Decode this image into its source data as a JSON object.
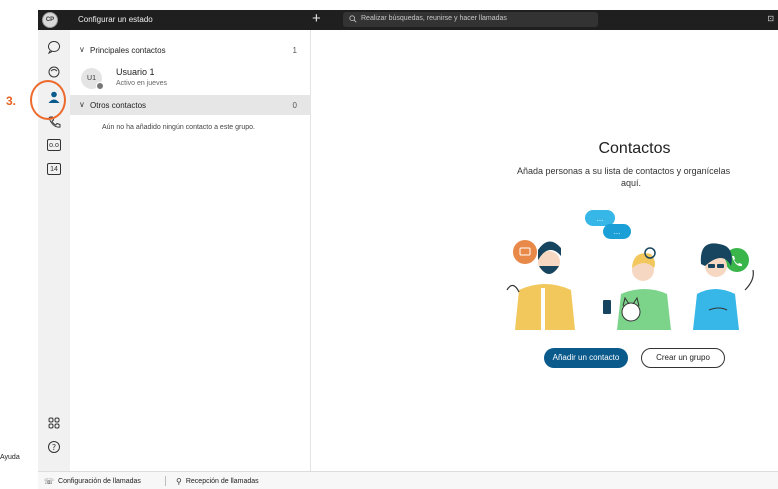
{
  "titlebar": {
    "avatar_initials": "CP",
    "status_text": "Configurar un estado",
    "new_icon": "+",
    "search_placeholder": "Realizar búsquedas, reunirse y hacer llamadas"
  },
  "annotation": {
    "step_label": "3."
  },
  "rail": {
    "items": [
      {
        "name": "messaging-icon"
      },
      {
        "name": "teams-icon"
      },
      {
        "name": "contacts-icon",
        "selected": true
      },
      {
        "name": "calling-icon"
      },
      {
        "name": "voicemail-icon",
        "label": "o.o"
      },
      {
        "name": "calendar-icon",
        "label": "14"
      }
    ],
    "help_label": "Ayuda"
  },
  "contacts": {
    "groups": [
      {
        "name": "Principales contactos",
        "count": "1"
      },
      {
        "name": "Otros contactos",
        "count": "0"
      }
    ],
    "contact": {
      "initials": "U1",
      "name": "Usuario 1",
      "status": "Activo en jueves"
    },
    "empty_note": "Aún no ha añadido ningún contacto a este grupo."
  },
  "main": {
    "title": "Contactos",
    "desc_line1": "Añada personas a su lista de contactos y organícelas",
    "desc_line2": "aquí.",
    "add_contact": "Añadir un contacto",
    "create_group": "Crear un grupo",
    "bubble_text": "..."
  },
  "statusbar": {
    "call_settings": "Configuración de llamadas",
    "call_pickup": "Recepción de llamadas"
  },
  "colors": {
    "accent": "#0a5a8c",
    "annotation": "#ec6a2c",
    "titlebar": "#1f1f1f"
  }
}
